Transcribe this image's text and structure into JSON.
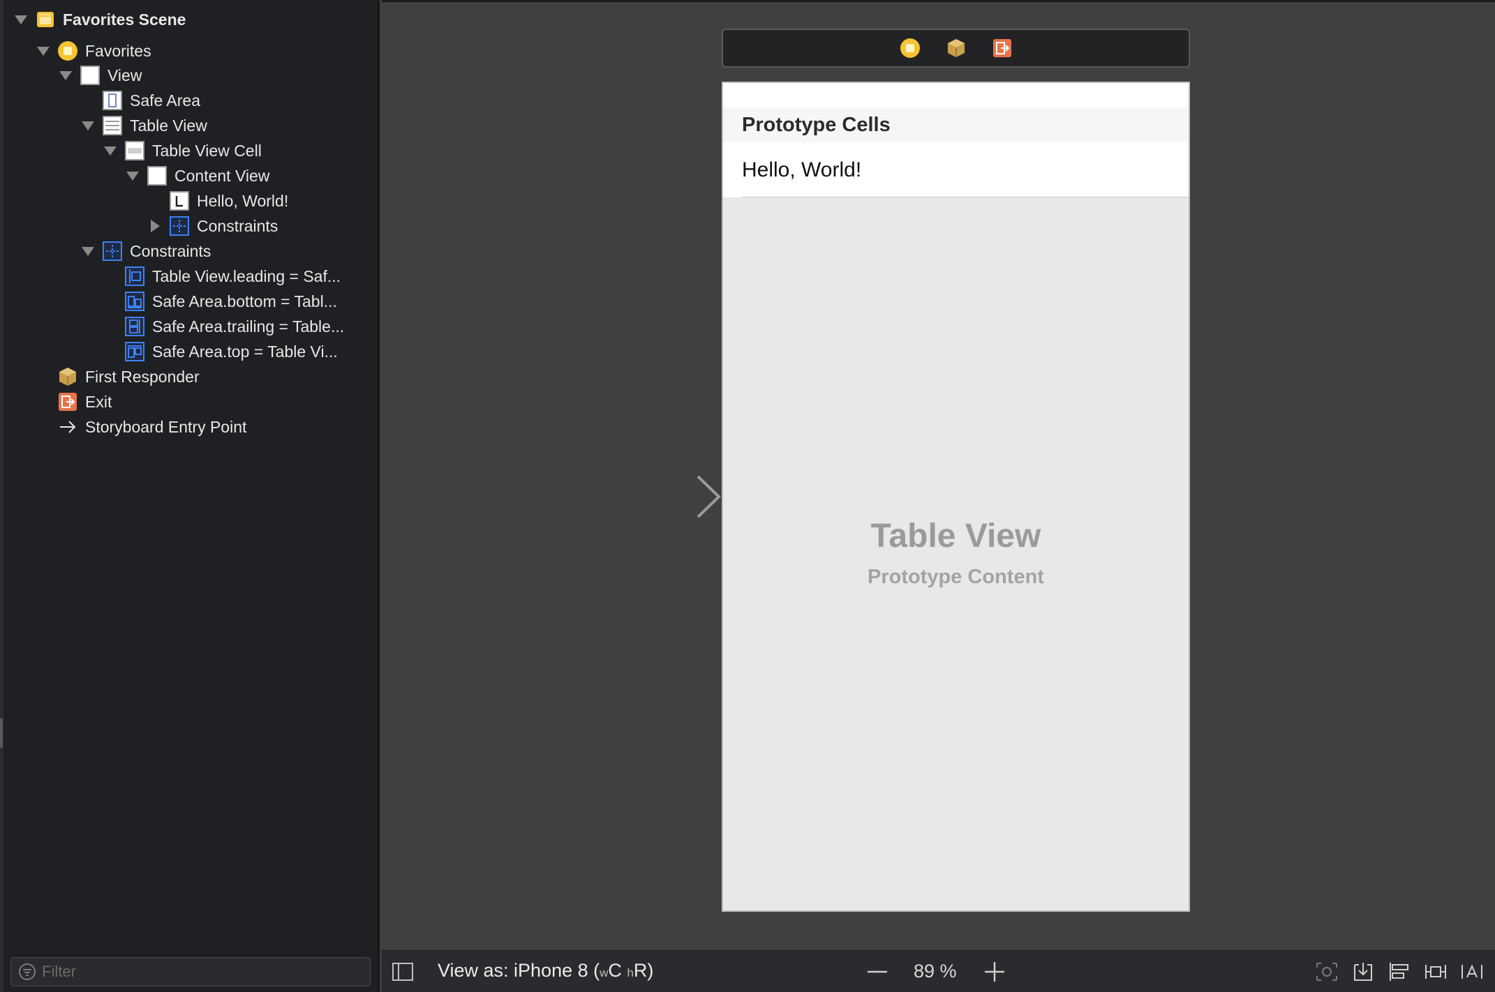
{
  "outline": {
    "items": [
      {
        "label": "Favorites Scene",
        "icon": "scene-icon",
        "disclosure": "expanded",
        "bold": true
      },
      {
        "label": "Favorites",
        "icon": "view-controller-icon",
        "disclosure": "expanded"
      },
      {
        "label": "View",
        "icon": "view-icon",
        "disclosure": "expanded"
      },
      {
        "label": "Safe Area",
        "icon": "safe-area-icon",
        "disclosure": "none"
      },
      {
        "label": "Table View",
        "icon": "table-view-icon",
        "disclosure": "expanded"
      },
      {
        "label": "Table View Cell",
        "icon": "table-view-cell-icon",
        "disclosure": "expanded"
      },
      {
        "label": "Content View",
        "icon": "view-icon",
        "disclosure": "expanded"
      },
      {
        "label": "Hello, World!",
        "icon": "label-icon",
        "disclosure": "none"
      },
      {
        "label": "Constraints",
        "icon": "constraints-icon",
        "disclosure": "collapsed"
      },
      {
        "label": "Constraints",
        "icon": "constraints-icon",
        "disclosure": "expanded"
      },
      {
        "label": "Table View.leading = Saf...",
        "icon": "leading-constraint-icon",
        "disclosure": "none"
      },
      {
        "label": "Safe Area.bottom = Tabl...",
        "icon": "bottom-constraint-icon",
        "disclosure": "none"
      },
      {
        "label": "Safe Area.trailing = Table...",
        "icon": "trailing-constraint-icon",
        "disclosure": "none"
      },
      {
        "label": "Safe Area.top = Table Vi...",
        "icon": "top-constraint-icon",
        "disclosure": "none"
      },
      {
        "label": "First Responder",
        "icon": "first-responder-icon",
        "disclosure": "none"
      },
      {
        "label": "Exit",
        "icon": "exit-icon",
        "disclosure": "none"
      },
      {
        "label": "Storyboard Entry Point",
        "icon": "entry-point-arrow-icon",
        "disclosure": "none"
      }
    ],
    "filter": {
      "placeholder": "Filter",
      "value": "",
      "icon": "filter-icon"
    }
  },
  "canvas": {
    "scene_dock": {
      "icons": [
        "view-controller-icon",
        "first-responder-icon",
        "exit-icon"
      ]
    },
    "entry_arrow_icon": "entry-point-arrow-icon",
    "table": {
      "section_header": "Prototype Cells",
      "cell_text": "Hello, World!",
      "placeholder_title": "Table View",
      "placeholder_subtitle": "Prototype Content"
    }
  },
  "bottom_bar": {
    "toggle_icon": "toggle-document-outline-icon",
    "view_as_prefix": "View as: iPhone 8 (",
    "size_class_w_small": "w",
    "size_class_w": "C",
    "size_class_h_small": "h",
    "size_class_h": "R)",
    "zoom_level": "89 %",
    "tools": [
      "update-frames-icon",
      "embed-in-icon",
      "align-icon",
      "add-constraints-icon",
      "resolve-issues-icon"
    ]
  },
  "colors": {
    "sidebar_bg": "#1f2023",
    "canvas_bg": "#404040",
    "scene_icon": "#f5c431",
    "exit_icon": "#e8734a",
    "constraint_blue": "#3b82f6"
  }
}
